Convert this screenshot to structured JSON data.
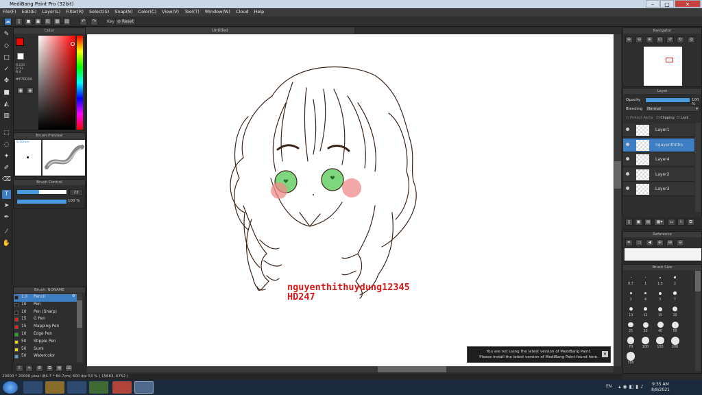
{
  "window": {
    "title": "MediBang Paint Pro (32bit)",
    "minimize": "–",
    "maximize": "□",
    "close": "✕"
  },
  "menu": [
    "File(F)",
    "Edit(E)",
    "Layer(L)",
    "Filter(R)",
    "Select(S)",
    "Snap(N)",
    "Color(C)",
    "View(V)",
    "Tool(T)",
    "Window(W)",
    "Cloud",
    "Help"
  ],
  "toolbar": {
    "key_label": "Key",
    "reset_label": "Reset"
  },
  "color_panel": {
    "title": "Color",
    "r": "R:233",
    "g": "G:13",
    "b": "B:4",
    "hex": "#E70D06",
    "primary": "#e70d06",
    "secondary": "#ffffff"
  },
  "brush_preview": {
    "title": "Brush Preview",
    "size_label": "0.50mm"
  },
  "brush_control": {
    "title": "Brush Control",
    "size_value": "23",
    "opacity_value": "100 %"
  },
  "brush_list": {
    "title": "Brush: NONAME",
    "items": [
      {
        "size": "1.0",
        "name": "Pencil",
        "color": "#222222",
        "selected": true
      },
      {
        "size": "10",
        "name": "Pen",
        "color": "#222222"
      },
      {
        "size": "10",
        "name": "Pen (Sharp)",
        "color": "#222222"
      },
      {
        "size": "15",
        "name": "G Pen",
        "color": "#e31c1c"
      },
      {
        "size": "15",
        "name": "Mapping Pen",
        "color": "#e31c1c"
      },
      {
        "size": "10",
        "name": "Edge Pen",
        "color": "#22aa22"
      },
      {
        "size": "50",
        "name": "Stipple Pen",
        "color": "#e6d21a"
      },
      {
        "size": "50",
        "name": "Sumi",
        "color": "#e6d21a"
      },
      {
        "size": "50",
        "name": "Watercolor",
        "color": "#5aa0d8"
      }
    ]
  },
  "document": {
    "tab_title": "Untitled"
  },
  "artwork": {
    "signature_line1": "nguyenthithuydung12345",
    "signature_line2": "HD247",
    "signature_color": "#d61a1a",
    "line_color": "#3a2418",
    "eye_color": "#7ed67e",
    "blush_color": "#f08a8a"
  },
  "notification": {
    "line1": "You are not using the latest version of MediBang Paint.",
    "line2": "Please install the latest version of MediBang Paint found here.",
    "close": "✕"
  },
  "navigator": {
    "title": "Navigator"
  },
  "layer_panel": {
    "title": "Layer",
    "opacity_label": "Opacity",
    "opacity_value": "100 %",
    "blending_label": "Blending",
    "blending_value": "Normal",
    "protect_alpha": "Protect Alpha",
    "clipping": "Clipping",
    "lock": "Lock",
    "layers": [
      {
        "name": "Layer1",
        "selected": false
      },
      {
        "name": "nguyenthitho",
        "selected": true
      },
      {
        "name": "Layer4",
        "selected": false
      },
      {
        "name": "Layer2",
        "selected": false
      },
      {
        "name": "Layer3",
        "selected": false
      }
    ]
  },
  "reference": {
    "title": "Reference"
  },
  "brush_size": {
    "title": "Brush Size",
    "sizes": [
      "0.7",
      "1",
      "1.5",
      "2",
      "3",
      "4",
      "5",
      "7",
      "10",
      "12",
      "15",
      "20",
      "25",
      "30",
      "40",
      "50",
      "70",
      "100",
      "150",
      "200",
      "300"
    ]
  },
  "status": {
    "text": "20000 * 20000 pixel  (84.7 * 84.7cm)  600 dpi  53 %  ( 15663, 6752 )"
  },
  "taskbar": {
    "lang": "EN",
    "time": "9:35 AM",
    "date": "8/8/2021"
  }
}
